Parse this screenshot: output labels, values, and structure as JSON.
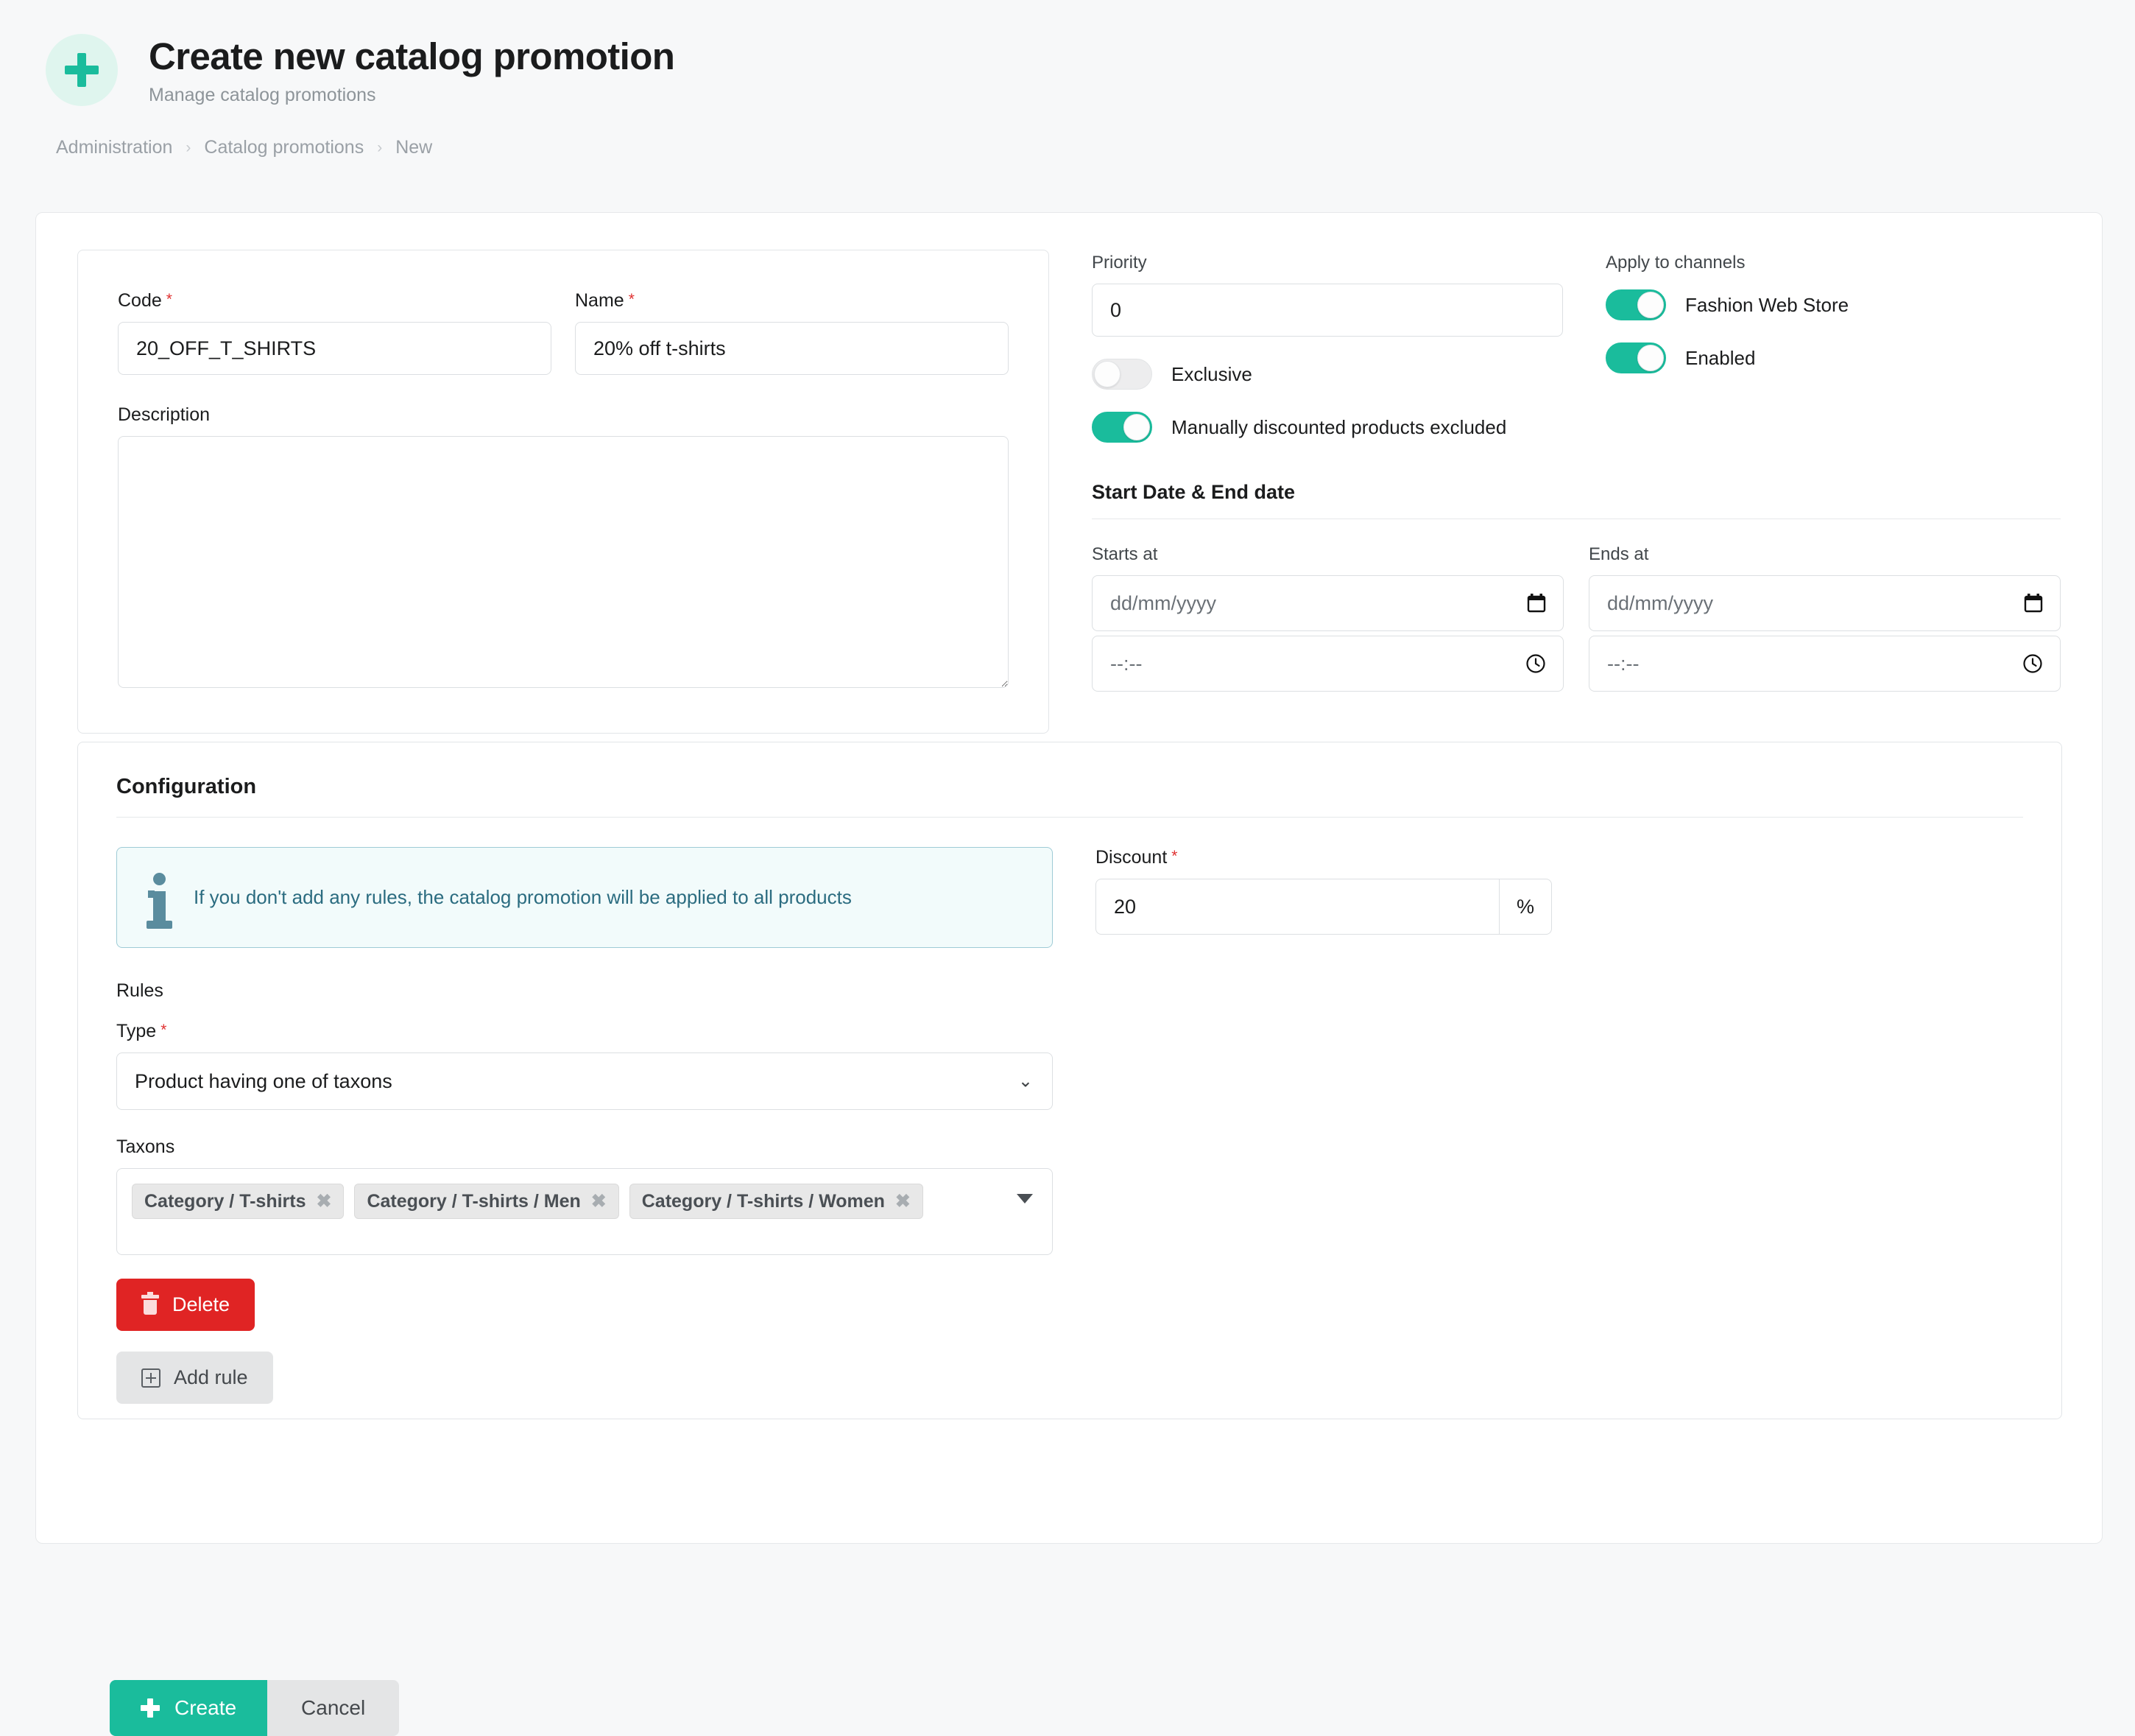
{
  "header": {
    "icon": "plus-icon",
    "title": "Create new catalog promotion",
    "subtitle": "Manage catalog promotions"
  },
  "breadcrumb": {
    "items": [
      "Administration",
      "Catalog promotions",
      "New"
    ],
    "separator": "›"
  },
  "form": {
    "code": {
      "label": "Code",
      "required": "*",
      "value": "20_OFF_T_SHIRTS"
    },
    "name": {
      "label": "Name",
      "required": "*",
      "value": "20% off t-shirts"
    },
    "description": {
      "label": "Description",
      "value": "",
      "placeholder": ""
    },
    "priority": {
      "label": "Priority",
      "value": "0"
    },
    "exclusive": {
      "label": "Exclusive",
      "state": "off"
    },
    "manually_discounted": {
      "label": "Manually discounted products excluded",
      "state": "on"
    },
    "channels": {
      "label": "Apply to channels",
      "items": [
        {
          "label": "Fashion Web Store",
          "state": "on"
        },
        {
          "label": "Enabled",
          "state": "on"
        }
      ]
    },
    "dates": {
      "section_title": "Start Date & End date",
      "starts_at": {
        "label": "Starts at",
        "date_placeholder": "dd/mm/yyyy",
        "time_placeholder": "--:--"
      },
      "ends_at": {
        "label": "Ends at",
        "date_placeholder": "dd/mm/yyyy",
        "time_placeholder": "--:--"
      }
    }
  },
  "configuration": {
    "title": "Configuration",
    "info_message": "If you don't add any rules, the catalog promotion will be applied to all products",
    "rules_label": "Rules",
    "type": {
      "label": "Type",
      "required": "*",
      "value": "Product having one of taxons"
    },
    "taxons": {
      "label": "Taxons",
      "tags": [
        "Category / T-shirts",
        "Category / T-shirts / Men",
        "Category / T-shirts / Women"
      ],
      "remove_glyph": "✖"
    },
    "delete_button": "Delete",
    "add_rule_button": "Add rule",
    "discount": {
      "label": "Discount",
      "required": "*",
      "value": "20",
      "suffix": "%"
    }
  },
  "footer": {
    "create_button": "Create",
    "cancel_button": "Cancel"
  },
  "colors": {
    "accent": "#1abc9c",
    "danger": "#e02424",
    "info_border": "#9ecbd6",
    "info_bg": "#f2fbfb",
    "info_text": "#2b6c80",
    "required": "#e03030",
    "page_bg": "#f7f8f9"
  }
}
